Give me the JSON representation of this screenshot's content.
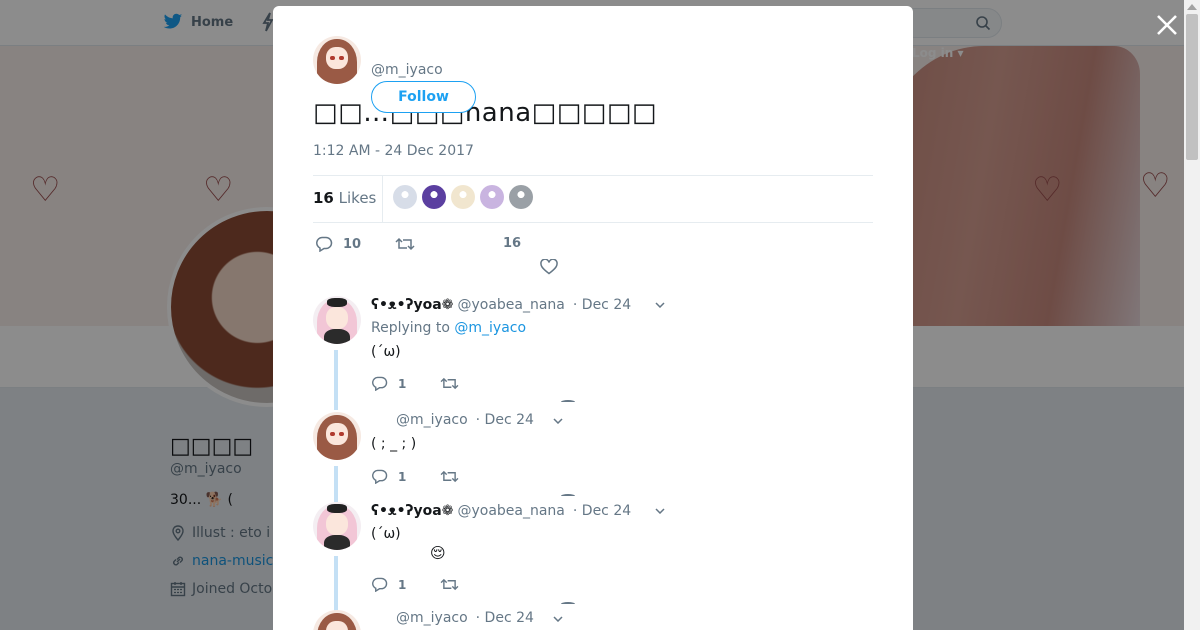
{
  "topbar": {
    "home_label": "Home",
    "login_label": "Log in",
    "login_caret": "▾"
  },
  "profile": {
    "name": "□□□□",
    "handle": "@m_iyaco",
    "bio": "30...  🐕 (",
    "location": "Illust : eto i",
    "link": "nana-music",
    "joined": "Joined Octo"
  },
  "banner": {
    "heart_glyph": "♡"
  },
  "tweet": {
    "author_handle": "@m_iyaco",
    "follow_label": "Follow",
    "text": "□□…□□□nana□□□□□",
    "time": "1:12 AM - 24 Dec 2017",
    "likes_count": "16",
    "likes_label": "Likes",
    "reply_count": "10",
    "like_count": "16"
  },
  "likers": [
    {
      "name": "liker-1",
      "color": "#d7dde8"
    },
    {
      "name": "liker-2",
      "color": "#5b3fa0"
    },
    {
      "name": "liker-3",
      "color": "#f1e6cf"
    },
    {
      "name": "liker-4",
      "color": "#c9b4e0"
    },
    {
      "name": "liker-5",
      "color": "#9aa0a6"
    }
  ],
  "replies": [
    {
      "name": "ʕ•ᴥ•ʔyoa❁",
      "handle": "@yoabea_nana",
      "date": "· Dec 24",
      "replying_prefix": "Replying to",
      "replying_to": "@m_iyaco",
      "text": "(´ω)",
      "reply_count": "1",
      "avatar": "pink"
    },
    {
      "name": "",
      "handle": "@m_iyaco",
      "date": "· Dec 24",
      "text": "( ; _ ; )",
      "reply_count": "1",
      "avatar": "brown"
    },
    {
      "name": "ʕ•ᴥ•ʔyoa❁",
      "handle": "@yoabea_nana",
      "date": "· Dec 24",
      "text": "(´ω)",
      "emoji": "😌",
      "reply_count": "1",
      "avatar": "pink"
    },
    {
      "name": "",
      "handle": "@m_iyaco",
      "date": "· Dec 24",
      "avatar": "brown"
    }
  ],
  "colors": {
    "accent": "#1da1f2",
    "link": "#1b95e0",
    "muted": "#657786",
    "thread": "#c4e0f5"
  }
}
